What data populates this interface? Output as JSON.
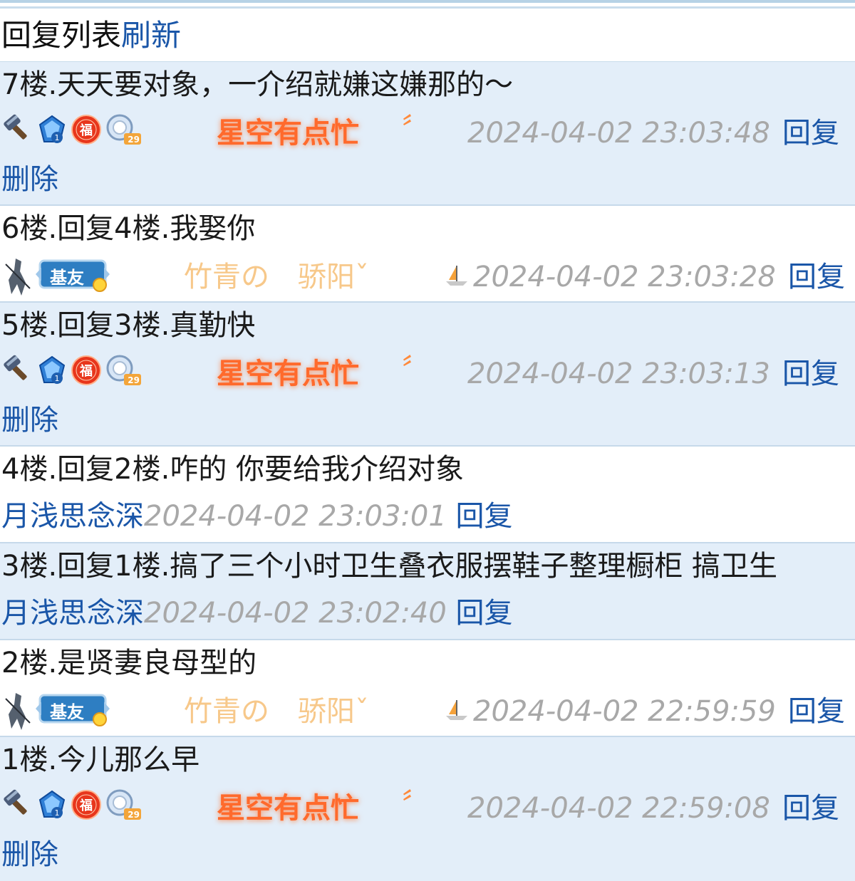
{
  "header": {
    "title": "回复列表",
    "refresh": "刷新"
  },
  "replies": [
    {
      "floor_text": "7楼.天天要对象，一介绍就嫌这嫌那的～",
      "user": "星空有点忙",
      "user_suffix": "〞",
      "time": "2024-04-02 23:03:48",
      "reply": "回复",
      "delete": "删除",
      "level": "29"
    },
    {
      "floor_text": "6楼.回复4楼.我娶你",
      "user": "竹青の　骄阳ˇ",
      "time": "2024-04-02 23:03:28",
      "reply": "回复",
      "badge_text": "基友"
    },
    {
      "floor_text": "5楼.回复3楼.真勤快",
      "user": "星空有点忙",
      "user_suffix": "〞",
      "time": "2024-04-02 23:03:13",
      "reply": "回复",
      "delete": "删除",
      "level": "29"
    },
    {
      "floor_text": "4楼.回复2楼.咋的 你要给我介绍对象",
      "user": "月浅思念深",
      "time": "2024-04-02 23:03:01",
      "reply": "回复"
    },
    {
      "floor_text": "3楼.回复1楼.搞了三个小时卫生叠衣服摆鞋子整理橱柜 搞卫生",
      "user": "月浅思念深",
      "time": "2024-04-02 23:02:40",
      "reply": "回复"
    },
    {
      "floor_text": "2楼.是贤妻良母型的",
      "user": "竹青の　骄阳ˇ",
      "time": "2024-04-02 22:59:59",
      "reply": "回复",
      "badge_text": "基友"
    },
    {
      "floor_text": "1楼.今儿那么早",
      "user": "星空有点忙",
      "user_suffix": "〞",
      "time": "2024-04-02 22:59:08",
      "reply": "回复",
      "delete": "删除",
      "level": "29"
    }
  ],
  "badge_glyphs": {
    "fu": "福"
  },
  "colors": {
    "link": "#1a56a8",
    "fire_user": "#ff6a2c",
    "gold_user": "#f7c88a",
    "time": "#a8a8a8",
    "row_alt": "#e3eef9",
    "divider": "#c6d9ea"
  },
  "icons": [
    "hammer-icon",
    "vip-gem-icon",
    "fu-seal-icon",
    "level-ring-icon",
    "swordsman-avatar-icon",
    "jiyou-badge-icon",
    "sailboat-icon"
  ]
}
